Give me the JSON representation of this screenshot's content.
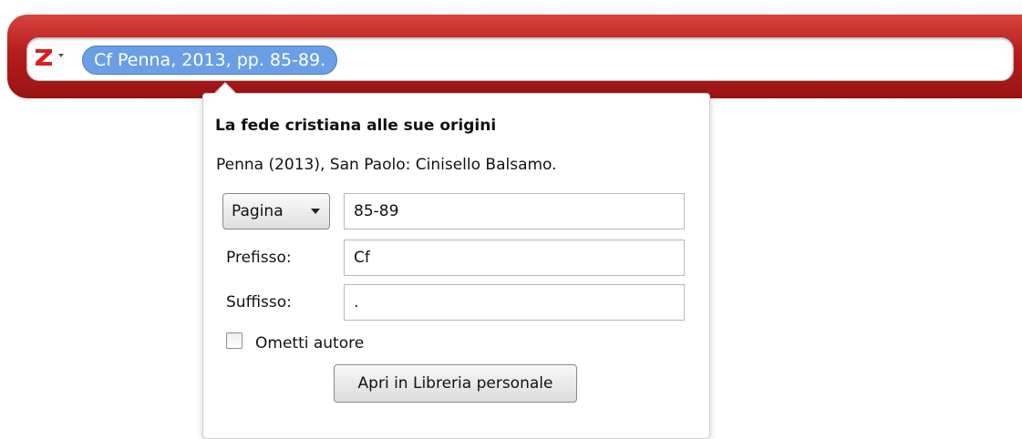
{
  "quick_format": {
    "logo_icon": "zotero-z-logo-icon",
    "menu_icon": "chevron-down-icon",
    "citation_bubble": "Cf Penna, 2013, pp. 85-89."
  },
  "popup": {
    "item_title": "La fede cristiana alle sue origini",
    "item_info": "Penna (2013), San Paolo: Cinisello Balsamo.",
    "locator": {
      "selected": "Pagina",
      "value": "85-89"
    },
    "prefix": {
      "label": "Prefisso:",
      "value": "Cf"
    },
    "suffix": {
      "label": "Suffisso:",
      "value": "."
    },
    "omit_author": {
      "label": "Ometti autore",
      "checked": false
    },
    "open_button": "Apri in Libreria personale"
  },
  "colors": {
    "bar_red": "#b41d1d",
    "bubble_blue": "#6a9fe6",
    "logo_red": "#d9201d"
  }
}
